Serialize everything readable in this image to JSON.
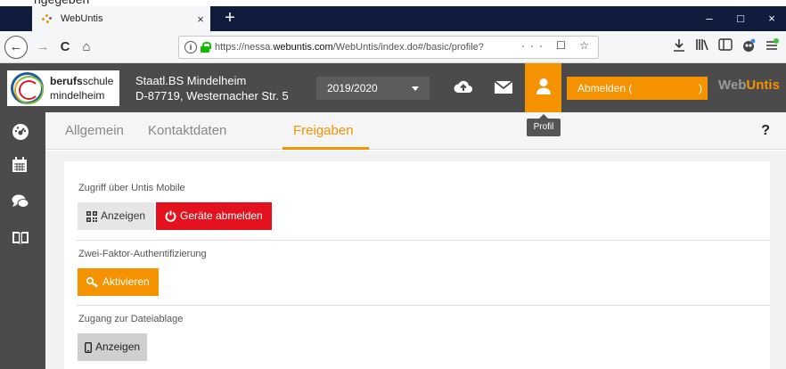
{
  "browser": {
    "top_crop_text": "ngegeben",
    "tab_title": "WebUntis",
    "tab_close": "×",
    "new_tab": "+",
    "window_controls": {
      "minimize": "–",
      "maximize": "□",
      "close": "×"
    },
    "nav": {
      "back": "←",
      "forward": "→",
      "reload": "C",
      "home": "⌂"
    },
    "url": {
      "prefix": "https://nessa.",
      "host": "webuntis.com",
      "rest": "/WebUntis/index.do#/basic/profile?"
    },
    "url_actions": "··· ☐ ☆",
    "toolbar_icons": [
      "download-icon",
      "library-icon",
      "sidebar-icon",
      "extension-icon",
      "menu-icon"
    ]
  },
  "header": {
    "logo_text_bold": "berufs",
    "logo_text_rest": "schule",
    "logo_text_line2": "mindelheim",
    "school_name": "Staatl.BS Mindelheim",
    "school_address": "D-87719, Westernacher Str. 5",
    "school_year": "2019/2020",
    "logout_label": "Abmelden (",
    "logout_close": ")",
    "brand_web": "Web",
    "brand_untis": "Untis",
    "profile_tooltip": "Profil"
  },
  "tabs": [
    {
      "label": "Allgemein",
      "active": false
    },
    {
      "label": "Kontaktdaten",
      "active": false
    },
    {
      "label": "Freigaben",
      "active": true
    }
  ],
  "help_label": "?",
  "sections": {
    "mobile": {
      "label": "Zugriff über Untis Mobile",
      "show_button": "Anzeigen",
      "logout_devices_button": "Geräte abmelden"
    },
    "twofactor": {
      "label": "Zwei-Faktor-Authentifizierung",
      "activate_button": "Aktivieren"
    },
    "files": {
      "label": "Zugang zur Dateiablage",
      "show_button": "Anzeigen"
    }
  },
  "colors": {
    "accent": "#f49200",
    "danger": "#e3121e",
    "header_bg": "#4b4b4b",
    "browser_tabbar": "#0f1c3d"
  }
}
